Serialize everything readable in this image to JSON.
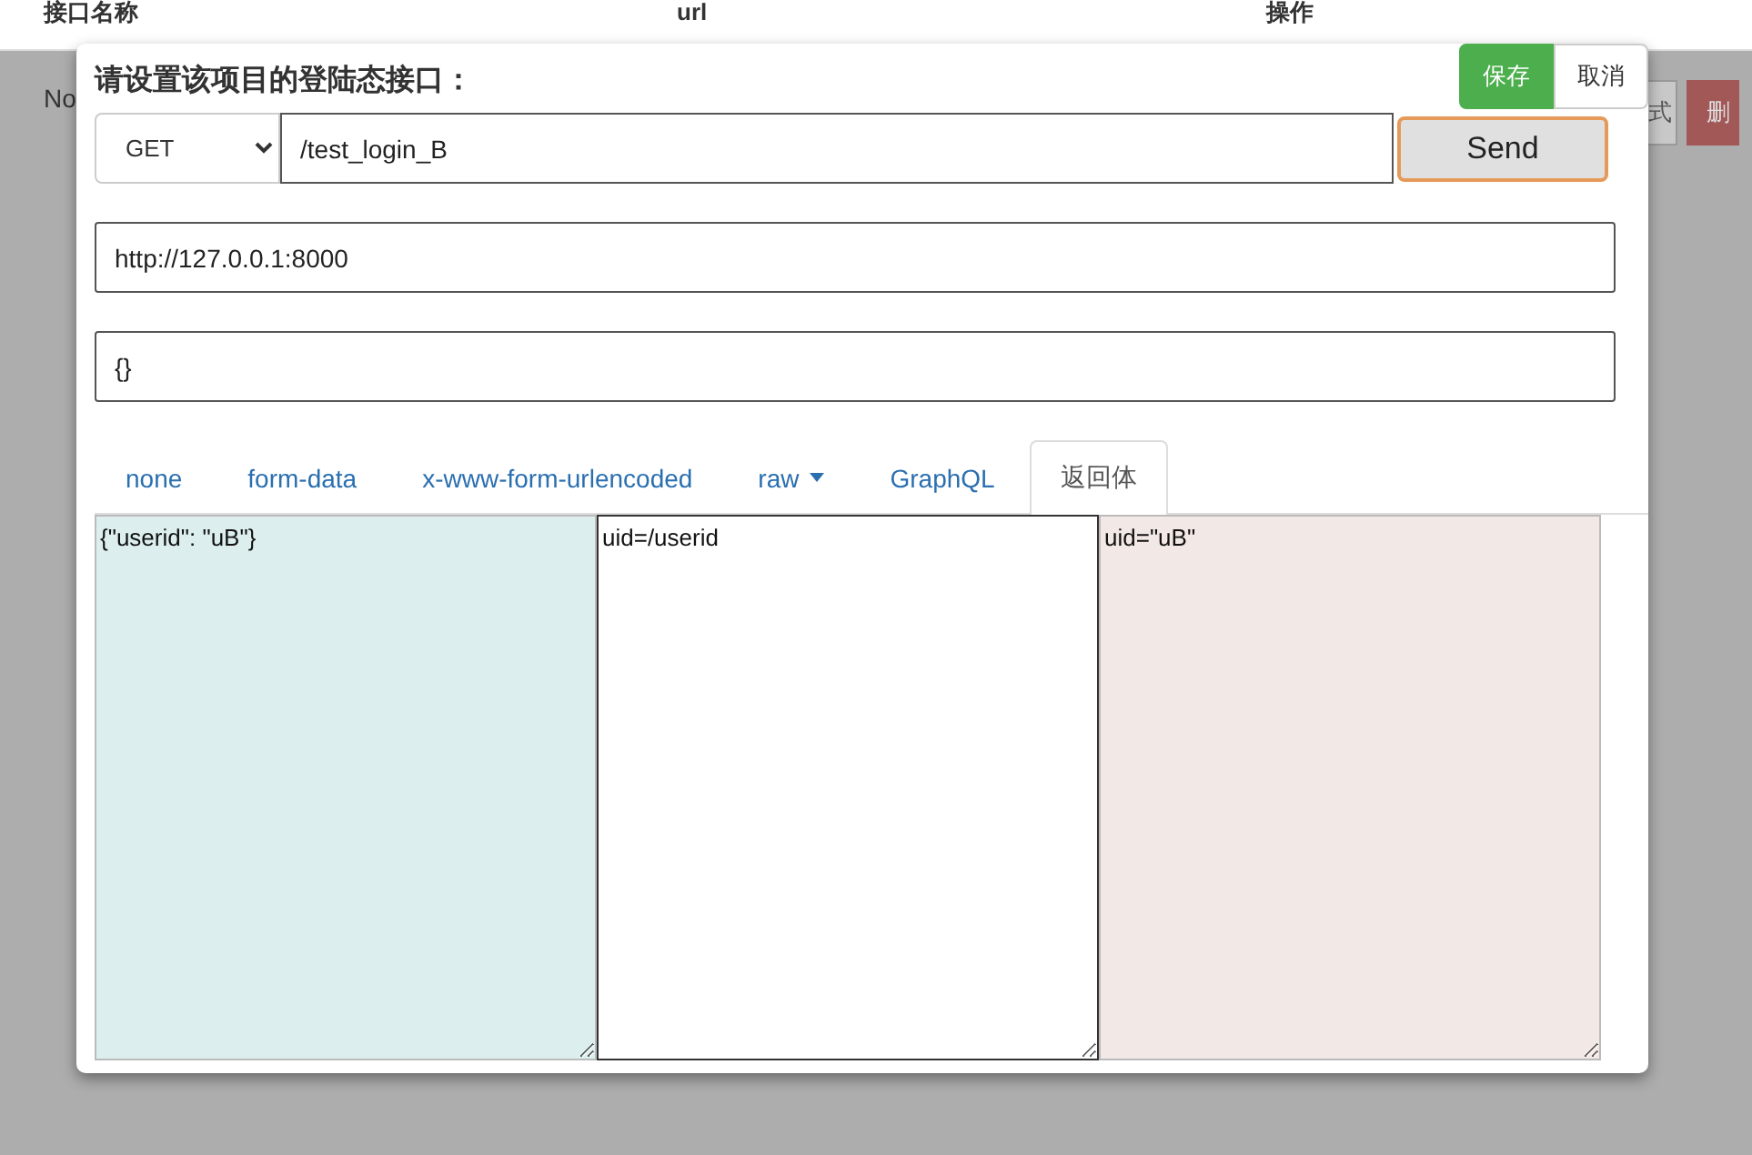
{
  "table": {
    "columns": [
      "接口名称",
      "url",
      "操作"
    ],
    "row_text": "No",
    "row_buttons": [
      {
        "label": "式",
        "kind": "default"
      },
      {
        "label": "删",
        "kind": "danger"
      }
    ]
  },
  "dialog": {
    "title": "请设置该项目的登陆态接口：",
    "buttons": [
      {
        "label": "保存",
        "kind": "primary"
      },
      {
        "label": "取消",
        "kind": "default"
      }
    ],
    "method": "GET",
    "path": "/test_login_B",
    "send": "Send",
    "host": "http://127.0.0.1:8000",
    "body": "{}",
    "tabs": [
      {
        "label": "none",
        "selected": false,
        "dropdown": false
      },
      {
        "label": "form-data",
        "selected": false,
        "dropdown": false
      },
      {
        "label": "x-www-form-urlencoded",
        "selected": false,
        "dropdown": false
      },
      {
        "label": "raw",
        "selected": false,
        "dropdown": true
      },
      {
        "label": "GraphQL",
        "selected": false,
        "dropdown": false
      },
      {
        "label": "返回体",
        "selected": true,
        "dropdown": false
      }
    ],
    "panes": [
      {
        "value": "{\"userid\": \"uB\"}",
        "kind": "response"
      },
      {
        "value": "uid=/userid",
        "kind": "extract"
      },
      {
        "value": "uid=\"uB\"",
        "kind": "result"
      }
    ]
  }
}
